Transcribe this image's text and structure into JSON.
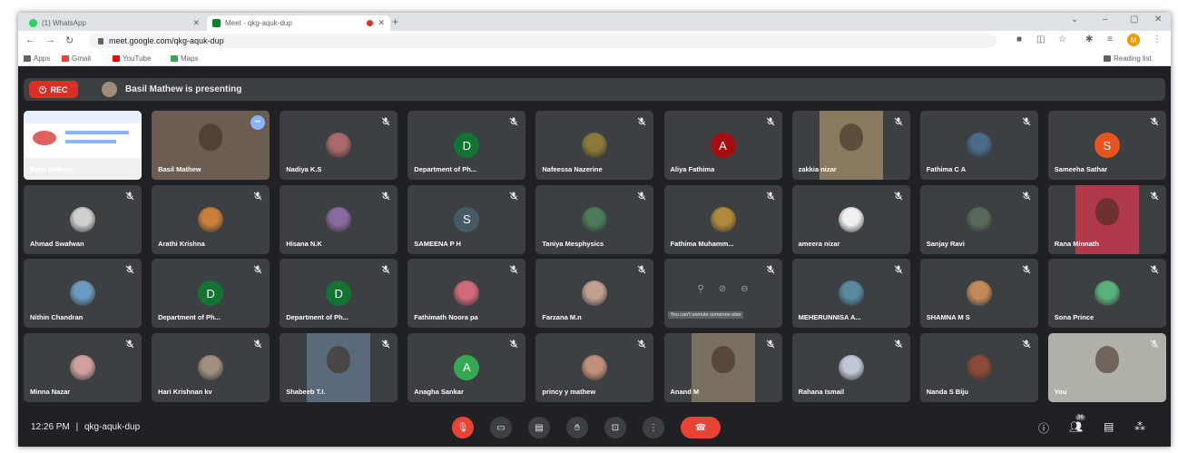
{
  "browser": {
    "tabs": [
      {
        "title": "(1) WhatsApp",
        "favicon_color": "#25d366",
        "active": false
      },
      {
        "title": "Meet - qkg-aquk-dup",
        "favicon_color": "#00832d",
        "active": true
      }
    ],
    "url": "meet.google.com/qkg-aquk-dup",
    "bookmarks": [
      {
        "label": "Apps",
        "color": "#5f6368"
      },
      {
        "label": "Gmail",
        "color": "#ea4335"
      },
      {
        "label": "YouTube",
        "color": "#ff0000"
      },
      {
        "label": "Maps",
        "color": "#34a853"
      }
    ],
    "reading_list": "Reading list",
    "profile_initial": "M"
  },
  "meet": {
    "rec_label": "REC",
    "presenting_text": "Basil Mathew is presenting",
    "participants": [
      {
        "name": "Basil Mathew",
        "kind": "screen"
      },
      {
        "name": "Basil Mathew",
        "kind": "video",
        "bg": "#6b5d52",
        "highlight": true
      },
      {
        "name": "Nadiya K.S",
        "kind": "photo",
        "color": "#a86a6a"
      },
      {
        "name": "Department of Ph...",
        "kind": "letter",
        "letter": "D",
        "color": "#137333"
      },
      {
        "name": "Nafeessa Nazerine",
        "kind": "photo",
        "color": "#8a7a3a"
      },
      {
        "name": "Aliya Fathima",
        "kind": "letter",
        "letter": "A",
        "color": "#a50e0e"
      },
      {
        "name": "zakkia nizar",
        "kind": "video",
        "bg": "#8a7a60"
      },
      {
        "name": "Fathima C A",
        "kind": "photo",
        "color": "#4a6b8a"
      },
      {
        "name": "Sameeha Sathar",
        "kind": "letter",
        "letter": "S",
        "color": "#e8541e"
      },
      {
        "name": "Ahmad Swafwan",
        "kind": "photo",
        "color": "#cfcfcf"
      },
      {
        "name": "Arathi Krishna",
        "kind": "photo",
        "color": "#c9803a"
      },
      {
        "name": "Hisana N.K",
        "kind": "photo",
        "color": "#8a6aa0"
      },
      {
        "name": "SAMEENA P H",
        "kind": "letter",
        "letter": "S",
        "color": "#455a64"
      },
      {
        "name": "Taniya Mesphysics",
        "kind": "photo",
        "color": "#4a7a5a"
      },
      {
        "name": "Fathima Muhamm...",
        "kind": "photo",
        "color": "#b08a3a"
      },
      {
        "name": "ameera nizar",
        "kind": "photo",
        "color": "#f0f0f0"
      },
      {
        "name": "Sanjay Ravi",
        "kind": "photo",
        "color": "#5a6a5a"
      },
      {
        "name": "Rana Minnath",
        "kind": "video",
        "bg": "#b03a4a"
      },
      {
        "name": "Nithin Chandran",
        "kind": "photo",
        "color": "#6a9ac0"
      },
      {
        "name": "Department of Ph...",
        "kind": "letter",
        "letter": "D",
        "color": "#137333"
      },
      {
        "name": "Department of Ph...",
        "kind": "letter",
        "letter": "D",
        "color": "#137333"
      },
      {
        "name": "Fathimath Noora pa",
        "kind": "photo",
        "color": "#d06a7a"
      },
      {
        "name": "Farzana M.n",
        "kind": "photo",
        "color": "#c0a090"
      },
      {
        "name": "",
        "kind": "hover",
        "tooltip": "You can't unmute someone else"
      },
      {
        "name": "MEHERUNNISA A...",
        "kind": "photo",
        "color": "#5a8aa0"
      },
      {
        "name": "SHAMNA M S",
        "kind": "photo",
        "color": "#c08a5a"
      },
      {
        "name": "Sona Prince",
        "kind": "photo",
        "color": "#5ab07a"
      },
      {
        "name": "Minna Nazar",
        "kind": "photo",
        "color": "#d0a0a0"
      },
      {
        "name": "Hari Krishnan kv",
        "kind": "photo",
        "color": "#a09080"
      },
      {
        "name": "Shabeeb T.I.",
        "kind": "video",
        "bg": "#5a6a7a"
      },
      {
        "name": "Anagha Sankar",
        "kind": "letter",
        "letter": "A",
        "color": "#34a853"
      },
      {
        "name": "princy y mathew",
        "kind": "photo",
        "color": "#c0907a"
      },
      {
        "name": "Anand M",
        "kind": "video",
        "bg": "#7a7060"
      },
      {
        "name": "Rahana Ismail",
        "kind": "photo",
        "color": "#c0c8d8"
      },
      {
        "name": "Nanda S Biju",
        "kind": "photo",
        "color": "#8a4a3a"
      },
      {
        "name": "You",
        "kind": "video",
        "bg": "#b0b0a8"
      }
    ],
    "time": "12:26 PM",
    "separator": "|",
    "meeting_code": "qkg-aquk-dup",
    "participant_count": "36"
  }
}
